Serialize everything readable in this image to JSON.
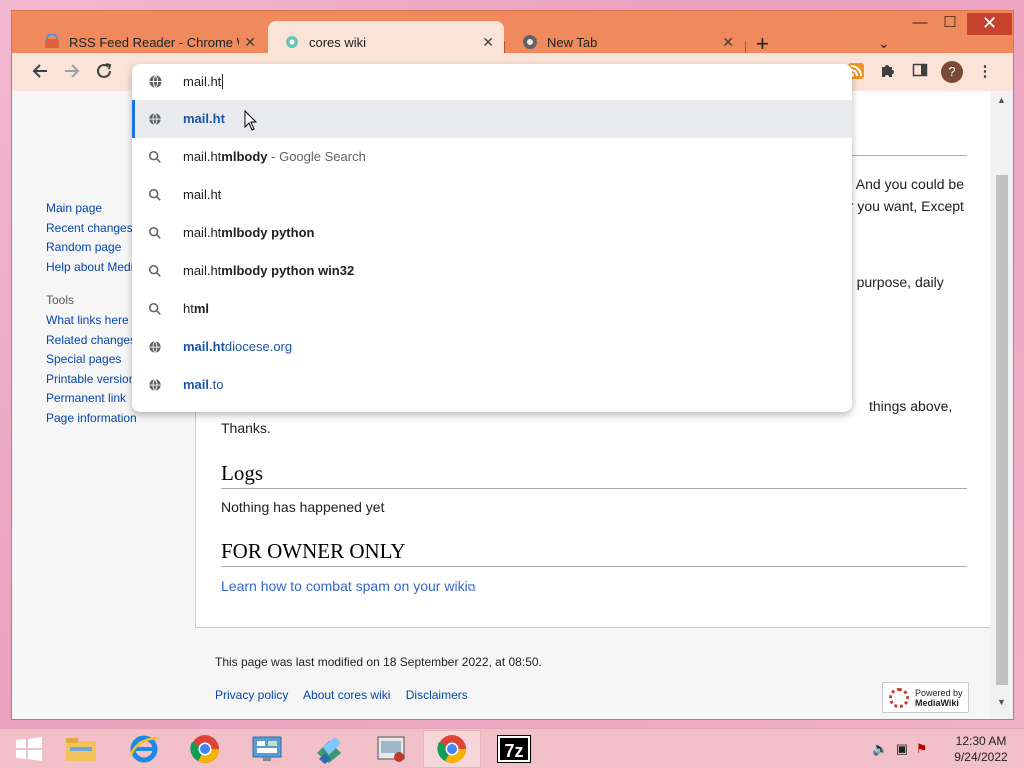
{
  "browser": {
    "tabs": [
      {
        "label": "RSS Feed Reader - Chrome Web Store",
        "icon": "rss-reader-favicon",
        "active": false
      },
      {
        "label": "cores wiki",
        "icon": "wiki-favicon",
        "active": true
      },
      {
        "label": "New Tab",
        "icon": "chrome-favicon",
        "active": false
      }
    ],
    "new_tab_symbol": "+",
    "tab_list_symbol": "⌄",
    "window_controls": {
      "minimize": "—",
      "maximize": "☐",
      "close": "✕"
    }
  },
  "omnibox": {
    "typed": "mail.ht",
    "suggestions": [
      {
        "icon": "globe-icon",
        "pre": "",
        "bold": "mail.ht",
        "post": "",
        "suffix": "",
        "style": "url",
        "selected": true
      },
      {
        "icon": "search-icon",
        "pre": "mail.ht",
        "bold": "mlbody",
        "post": "",
        "suffix": " - Google Search",
        "style": "search",
        "selected": false
      },
      {
        "icon": "search-icon",
        "pre": "mail.ht",
        "bold": "",
        "post": "",
        "suffix": "",
        "style": "search",
        "selected": false
      },
      {
        "icon": "search-icon",
        "pre": "mail.ht",
        "bold": "mlbody python",
        "post": "",
        "suffix": "",
        "style": "search",
        "selected": false
      },
      {
        "icon": "search-icon",
        "pre": "mail.ht",
        "bold": "mlbody python win32",
        "post": "",
        "suffix": "",
        "style": "search",
        "selected": false
      },
      {
        "icon": "search-icon",
        "pre": "ht",
        "bold": "ml",
        "post": "",
        "suffix": "",
        "style": "search",
        "selected": false
      },
      {
        "icon": "globe-icon",
        "pre": "",
        "bold": "mail.ht",
        "post": "diocese.org",
        "suffix": "",
        "style": "url",
        "selected": false
      },
      {
        "icon": "globe-icon",
        "pre": "",
        "bold": "mail",
        "post": ".to",
        "suffix": "",
        "style": "url",
        "selected": false
      }
    ]
  },
  "sidebar": {
    "nav": [
      "Main page",
      "Recent changes",
      "Random page",
      "Help about MediaWiki"
    ],
    "tools_heading": "Tools",
    "tools": [
      "What links here",
      "Related changes",
      "Special pages",
      "Printable version",
      "Permanent link",
      "Page information"
    ]
  },
  "content": {
    "frag1": "g. And you could be",
    "frag2": "er you want, Except",
    "frag3": "n, purpose, daily",
    "frag4": "things above,",
    "thanks": "Thanks.",
    "logs_heading": "Logs",
    "logs_text": "Nothing has happened yet",
    "owner_heading": "FOR OWNER ONLY",
    "spam_link": "Learn how to combat spam on your wiki"
  },
  "footer": {
    "modified": "This page was last modified on 18 September 2022, at 08:50.",
    "links": [
      "Privacy policy",
      "About cores wiki",
      "Disclaimers"
    ],
    "powered_by": "Powered by",
    "powered_name": "MediaWiki"
  },
  "taskbar": {
    "apps": [
      "start-icon",
      "file-explorer-icon",
      "internet-explorer-icon",
      "chrome-icon",
      "control-panel-icon",
      "package-icon",
      "media-icon",
      "chrome-active-icon",
      "7zip-icon"
    ],
    "sevenzip_label": "7z",
    "time": "12:30 AM",
    "date": "9/24/2022"
  },
  "colors": {
    "window_frame": "#f08a5d",
    "tab_active": "#fbe4d7",
    "link": "#0645ad",
    "suggestion_url": "#1a55a8",
    "selection_bar": "#1a73e8"
  }
}
